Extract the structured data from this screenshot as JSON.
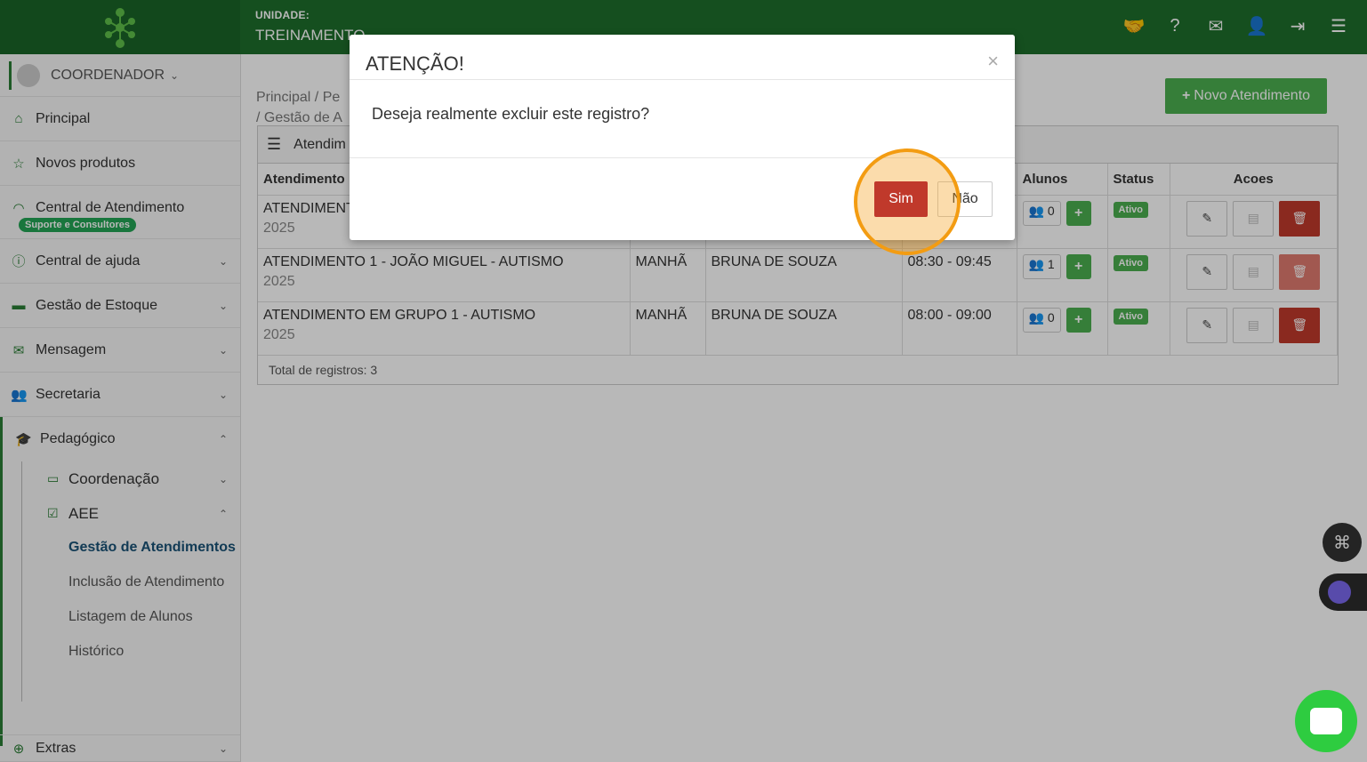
{
  "header": {
    "unit_label": "UNIDADE:",
    "unit_value": "TREINAMENTO"
  },
  "sidebar": {
    "user": "COORDENADOR",
    "items": [
      {
        "label": "Principal",
        "icon": "home-icon"
      },
      {
        "label": "Novos produtos",
        "icon": "star-icon"
      },
      {
        "label": "Central de Atendimento",
        "icon": "headset-icon",
        "badge": "Suporte e Consultores"
      },
      {
        "label": "Central de ajuda",
        "icon": "info-icon"
      },
      {
        "label": "Gestão de Estoque",
        "icon": "box-icon"
      },
      {
        "label": "Mensagem",
        "icon": "mail-icon"
      },
      {
        "label": "Secretaria",
        "icon": "users-icon"
      },
      {
        "label": "Pedagógico",
        "icon": "graduation-icon"
      },
      {
        "label": "Extras",
        "icon": "plus-circle-icon"
      }
    ],
    "sub": {
      "coordenacao": "Coordenação",
      "aee": "AEE",
      "leaves": [
        "Gestão de Atendimentos",
        "Inclusão de Atendimento",
        "Listagem de Alunos",
        "Histórico"
      ]
    }
  },
  "main": {
    "breadcrumb_line1": "Principal  /  Pe",
    "breadcrumb_line2": "/  Gestão de A",
    "new_button": "Novo Atendimento",
    "panel_title": "Atendim",
    "columns": [
      "Atendimento",
      "",
      "",
      "",
      "Alunos",
      "Status",
      "Acoes"
    ],
    "rows": [
      {
        "name": "ATENDIMENT",
        "year": "2025",
        "turno": "",
        "prof": "",
        "hora": "",
        "alunos": "0",
        "status": "Ativo"
      },
      {
        "name": "ATENDIMENTO 1 - JOÃO MIGUEL - AUTISMO",
        "year": "2025",
        "turno": "MANHÃ",
        "prof": "BRUNA DE SOUZA",
        "hora": "08:30 - 09:45",
        "alunos": "1",
        "status": "Ativo"
      },
      {
        "name": "ATENDIMENTO EM GRUPO 1 - AUTISMO",
        "year": "2025",
        "turno": "MANHÃ",
        "prof": "BRUNA DE SOUZA",
        "hora": "08:00 - 09:00",
        "alunos": "0",
        "status": "Ativo"
      }
    ],
    "total": "Total de registros: 3"
  },
  "modal": {
    "title": "ATENÇÃO!",
    "close": "×",
    "message": "Deseja realmente excluir este registro?",
    "yes": "Sim",
    "no": "Não"
  },
  "colors": {
    "green": "#1e6e2b",
    "danger": "#c0392b",
    "highlight": "#f39c12"
  }
}
